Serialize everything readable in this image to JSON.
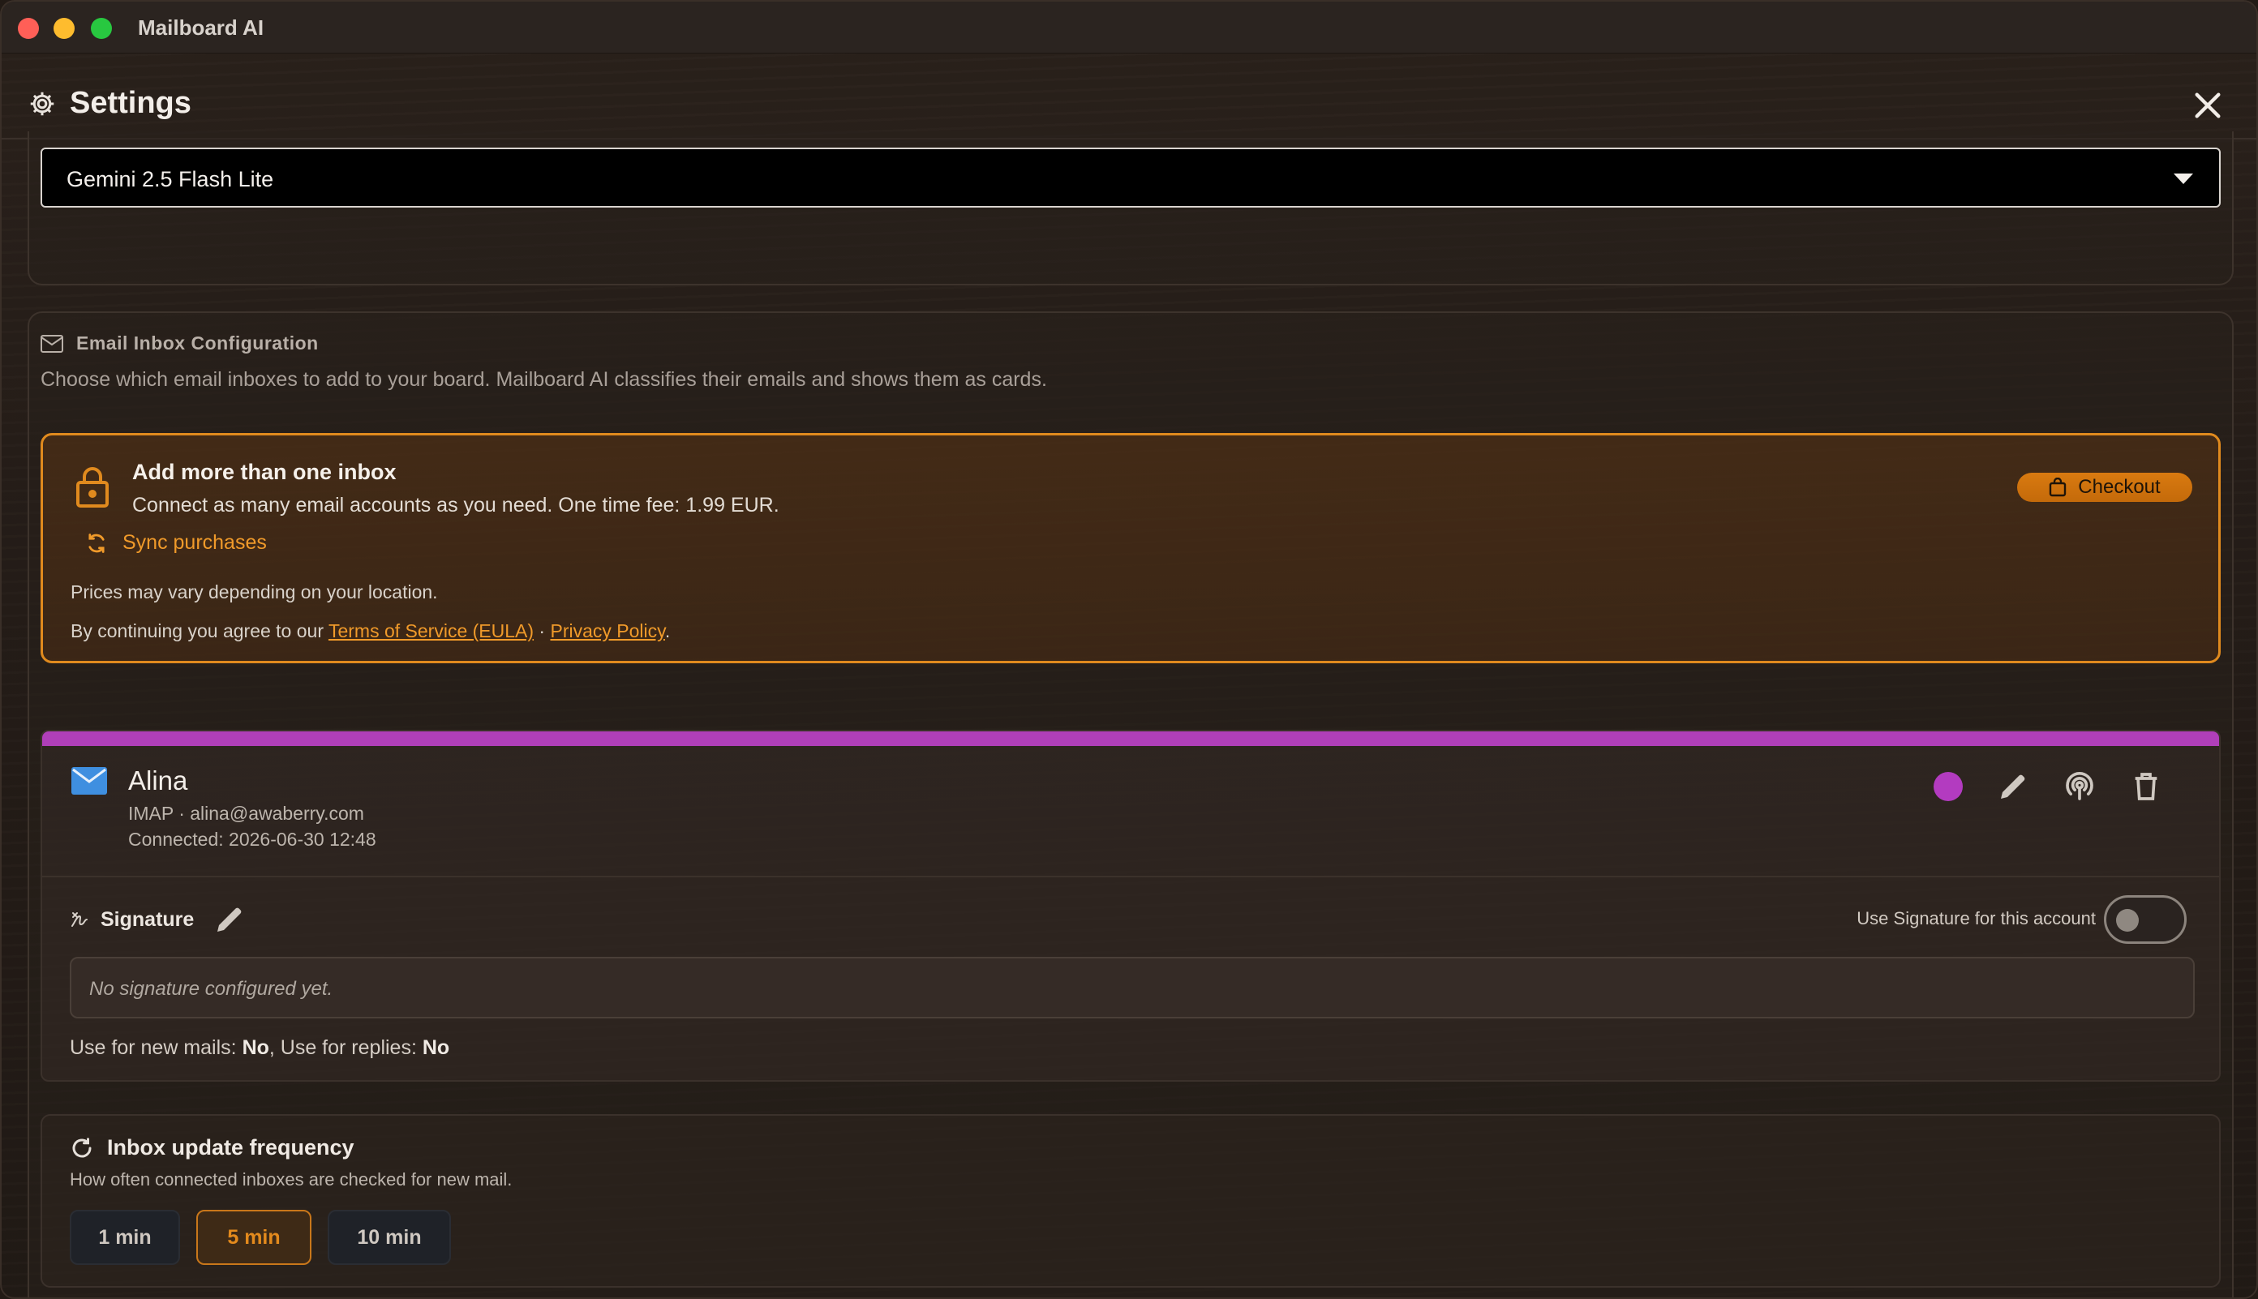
{
  "app": {
    "title": "Mailboard AI"
  },
  "settings": {
    "title": "Settings"
  },
  "model": {
    "selected": "Gemini 2.5 Flash Lite"
  },
  "inbox_config": {
    "heading": "Email Inbox Configuration",
    "description": "Choose which email inboxes to add to your board. Mailboard AI classifies their emails and shows them as cards."
  },
  "upsell": {
    "title": "Add more than one inbox",
    "description": "Connect as many email accounts as you need. One time fee: 1.99 EUR.",
    "sync_label": "Sync purchases",
    "checkout_label": "Checkout",
    "price_note": "Prices may vary depending on your location.",
    "terms_prefix": "By continuing you agree to our ",
    "terms_link": "Terms of Service (EULA)",
    "terms_sep": " · ",
    "privacy_link": "Privacy Policy",
    "terms_suffix": "."
  },
  "account": {
    "name": "Alina",
    "meta": "IMAP · alina@awaberry.com",
    "connected": "Connected: 2026-06-30 12:48",
    "color": "#b33bc0",
    "signature": {
      "label": "Signature",
      "toggle_label": "Use Signature for this account",
      "toggle_on": false,
      "placeholder": "No signature configured yet.",
      "usage_new_label": "Use for new mails: ",
      "usage_new_value": "No",
      "usage_sep": ", Use for replies: ",
      "usage_reply_value": "No"
    }
  },
  "frequency": {
    "title": "Inbox update frequency",
    "description": "How often connected inboxes are checked for new mail.",
    "options": [
      "1 min",
      "5 min",
      "10 min"
    ],
    "selected": "5 min"
  },
  "colors": {
    "accent": "#e08a1e",
    "account_bar": "#b03fb9"
  }
}
